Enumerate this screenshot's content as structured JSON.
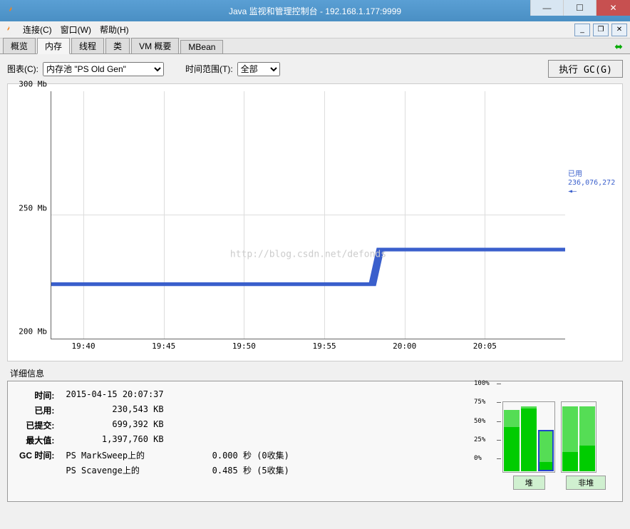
{
  "titlebar": {
    "title": "Java 监视和管理控制台 - 192.168.1.177:9999"
  },
  "menubar": {
    "connect": "连接(C)",
    "window": "窗口(W)",
    "help": "帮助(H)"
  },
  "tabs": {
    "overview": "概览",
    "memory": "内存",
    "threads": "线程",
    "classes": "类",
    "vm": "VM 概要",
    "mbean": "MBean"
  },
  "controls": {
    "chart_label": "图表(C):",
    "chart_select": "内存池 \"PS Old Gen\"",
    "time_label": "时间范围(T):",
    "time_select": "全部",
    "gc_button": "执行 GC(G)"
  },
  "chart_data": {
    "type": "line",
    "ylabel_unit": "Mb",
    "ylim": [
      200,
      300
    ],
    "y_ticks": [
      200,
      250,
      300
    ],
    "x_ticks": [
      "19:40",
      "19:45",
      "19:50",
      "19:55",
      "20:00",
      "20:05"
    ],
    "series": [
      {
        "name": "已用",
        "points": [
          {
            "x": "19:38",
            "y": 222
          },
          {
            "x": "19:58",
            "y": 222
          },
          {
            "x": "19:58.5",
            "y": 236
          },
          {
            "x": "20:08",
            "y": 236
          }
        ]
      }
    ],
    "current_label": "已用",
    "current_value": "236,076,272",
    "watermark": "http://blog.csdn.net/defonds"
  },
  "details": {
    "title": "详细信息",
    "rows": {
      "time_label": "时间:",
      "time_val": "2015-04-15 20:07:37",
      "used_label": "已用:",
      "used_val": "230,543 KB",
      "committed_label": "已提交:",
      "committed_val": "699,392 KB",
      "max_label": "最大值:",
      "max_val": "1,397,760 KB",
      "gc_label": "GC 时间:",
      "gc1_name": "PS MarkSweep上的",
      "gc1_val": "0.000 秒 (0收集)",
      "gc2_name": "PS Scavenge上的",
      "gc2_val": "0.485 秒 (5收集)"
    }
  },
  "bars": {
    "y_ticks": [
      "0%",
      "25%",
      "50%",
      "75%",
      "100%"
    ],
    "group1": [
      {
        "total": 90,
        "fill": 65
      },
      {
        "total": 95,
        "fill": 92
      },
      {
        "total": 60,
        "fill": 13
      }
    ],
    "group2": [
      {
        "total": 95,
        "fill": 28
      },
      {
        "total": 95,
        "fill": 38
      }
    ],
    "label_heap": "堆",
    "label_nonheap": "非堆"
  }
}
